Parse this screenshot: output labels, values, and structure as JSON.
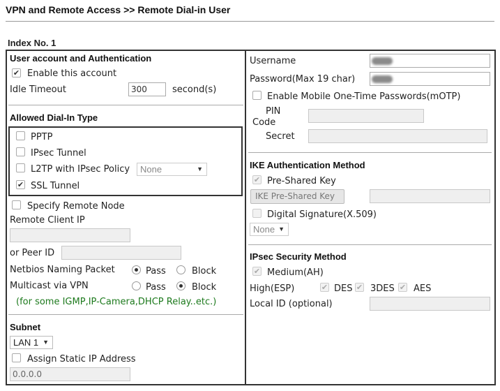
{
  "header": {
    "breadcrumb": "VPN and Remote Access >> Remote Dial-in User"
  },
  "profile": {
    "index_label": "Index No. 1"
  },
  "account": {
    "section_title": "User account and Authentication",
    "enable_label": "Enable this account",
    "enable_checked": true,
    "idle_timeout_label": "Idle Timeout",
    "idle_timeout_value": "300",
    "idle_timeout_unit": "second(s)"
  },
  "dial_in": {
    "section_title": "Allowed Dial-In Type",
    "options": [
      {
        "label": "PPTP",
        "checked": false
      },
      {
        "label": "IPsec Tunnel",
        "checked": false
      },
      {
        "label": "L2TP with IPsec Policy",
        "checked": false
      },
      {
        "label": "SSL Tunnel",
        "checked": true
      }
    ],
    "l2tp_policy_value": "None"
  },
  "remote_node": {
    "specify_label": "Specify Remote Node",
    "remote_client_ip_label": "Remote Client IP",
    "remote_client_ip_value": "",
    "peer_id_label": "or Peer ID",
    "peer_id_value": "",
    "netbios_label": "Netbios Naming Packet",
    "multicast_label": "Multicast via VPN",
    "pass_label": "Pass",
    "block_label": "Block",
    "netbios_choice": "Pass",
    "multicast_choice": "Block",
    "hint": "(for some IGMP,IP-Camera,DHCP Relay..etc.)"
  },
  "subnet": {
    "section_title": "Subnet",
    "lan_value": "LAN 1",
    "assign_static_label": "Assign Static IP Address",
    "static_ip_value": "0.0.0.0"
  },
  "credentials": {
    "username_label": "Username",
    "password_label": "Password(Max 19 char)",
    "motp_label": "Enable Mobile One-Time Passwords(mOTP)",
    "pin_code_label_line1": "PIN",
    "pin_code_label_line2": "Code",
    "secret_label": "Secret"
  },
  "ike": {
    "section_title": "IKE Authentication Method",
    "pre_shared_label": "Pre-Shared Key",
    "pre_shared_button": "IKE Pre-Shared Key",
    "digital_signature_label": "Digital Signature(X.509)",
    "signature_select_value": "None"
  },
  "ipsec": {
    "section_title": "IPsec Security Method",
    "medium_label": "Medium(AH)",
    "high_label": "High(ESP)",
    "des_label": "DES",
    "des3_label": "3DES",
    "aes_label": "AES",
    "local_id_label": "Local ID (optional)",
    "local_id_value": ""
  },
  "colors": {
    "border": "#333333",
    "hint_text": "#1d7a1d",
    "disabled_field": "#efefef"
  },
  "icons": {
    "checkbox": "check-mark-icon",
    "select_arrow": "triangle-down-icon"
  }
}
